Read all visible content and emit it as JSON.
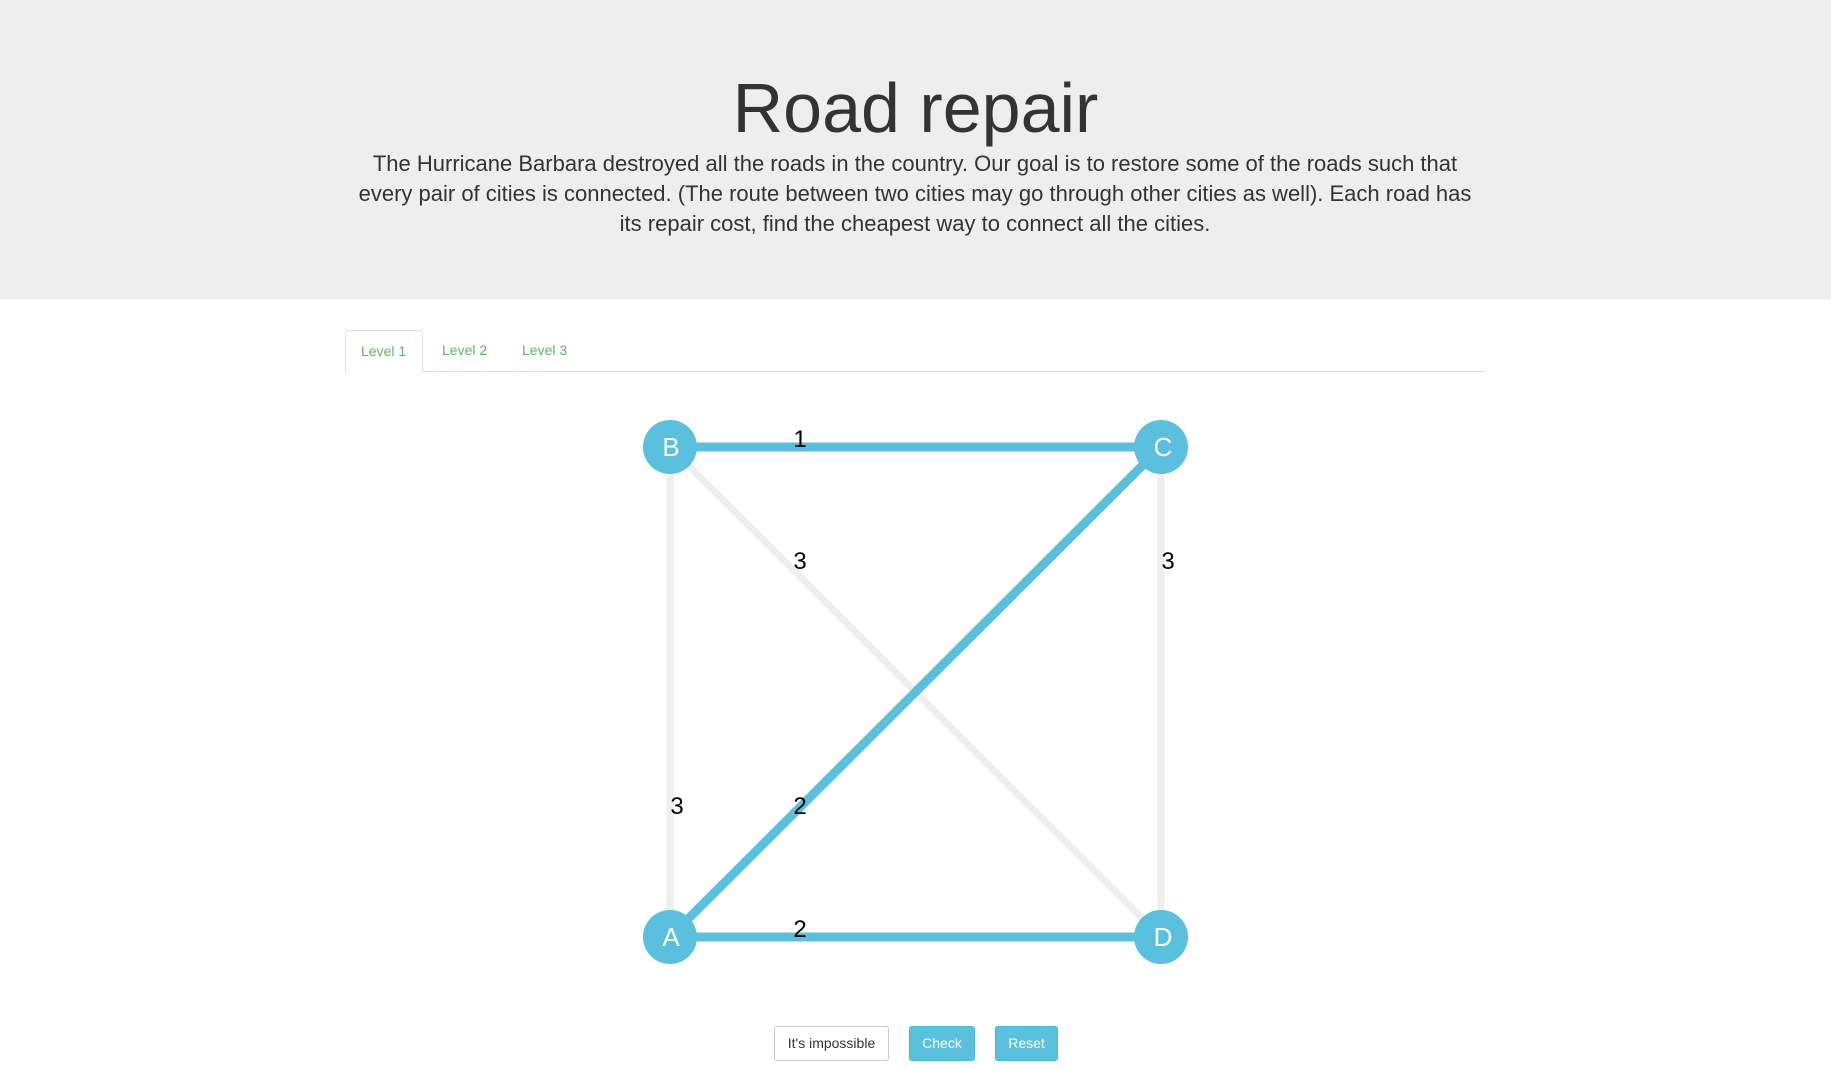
{
  "header": {
    "title": "Road repair",
    "description": "The Hurricane Barbara destroyed all the roads in the country. Our goal is to restore some of the roads such that every pair of cities is connected. (The route between two cities may go through other cities as well). Each road has its repair cost, find the cheapest way to connect all the cities."
  },
  "tabs": [
    {
      "label": "Level 1",
      "active": true
    },
    {
      "label": "Level 2",
      "active": false
    },
    {
      "label": "Level 3",
      "active": false
    }
  ],
  "graph": {
    "colors": {
      "selected": "#5bc0de",
      "unselected": "#eeeeee",
      "node": "#5bc0de"
    },
    "nodes": [
      "A",
      "B",
      "C",
      "D"
    ],
    "edges": [
      {
        "from": "B",
        "to": "C",
        "cost": "1",
        "selected": true
      },
      {
        "from": "B",
        "to": "D",
        "cost": "3",
        "selected": false
      },
      {
        "from": "C",
        "to": "D",
        "cost": "3",
        "selected": false
      },
      {
        "from": "A",
        "to": "B",
        "cost": "3",
        "selected": false
      },
      {
        "from": "A",
        "to": "C",
        "cost": "2",
        "selected": true
      },
      {
        "from": "A",
        "to": "D",
        "cost": "2",
        "selected": true
      }
    ]
  },
  "buttons": {
    "impossible": "It's impossible",
    "check": "Check",
    "reset": "Reset"
  }
}
